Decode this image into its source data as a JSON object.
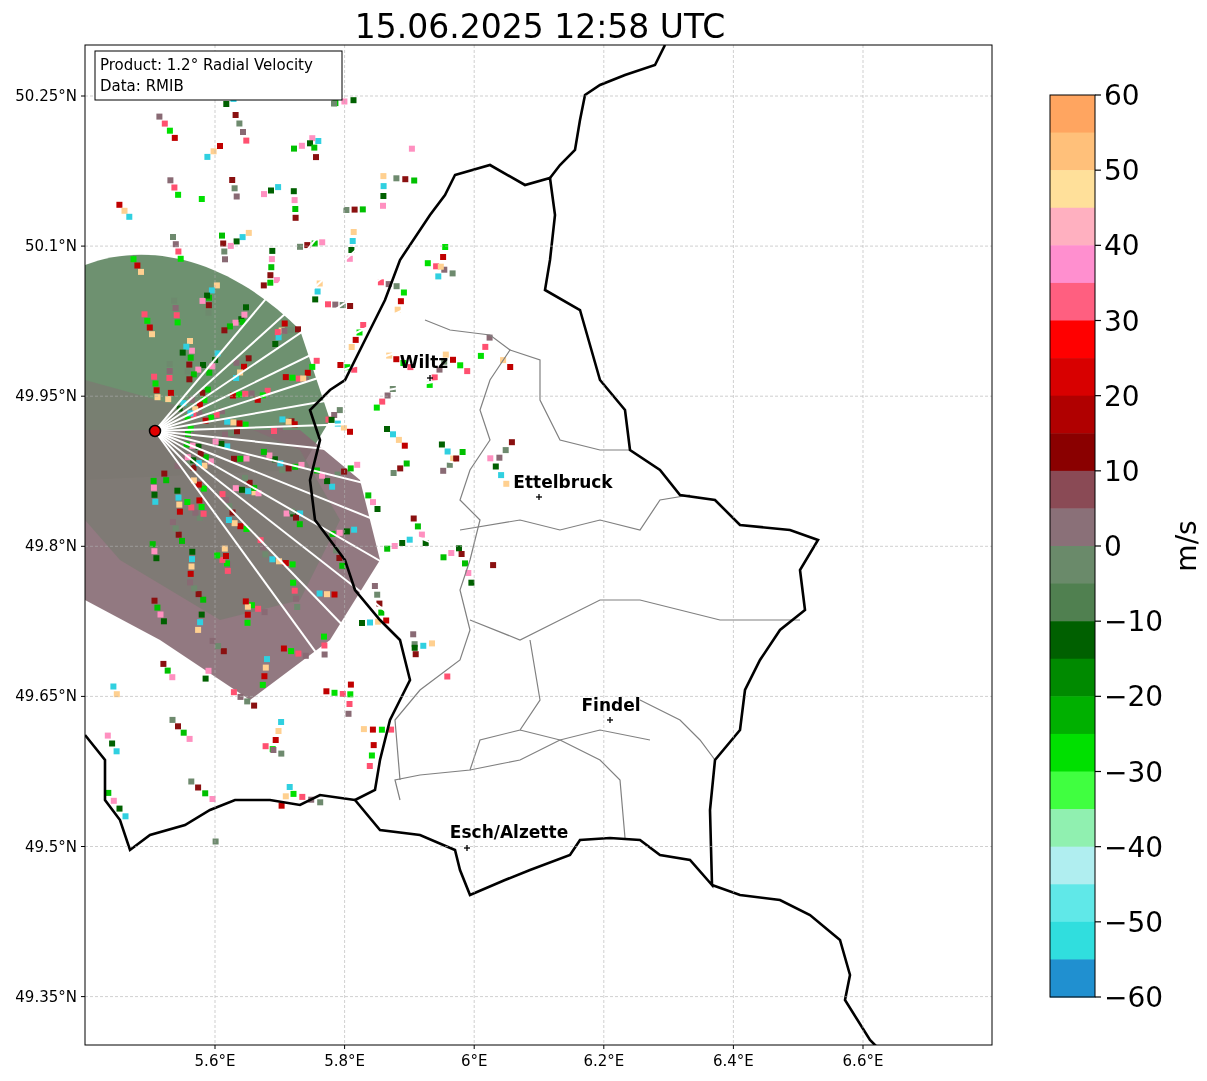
{
  "title": "15.06.2025 12:58 UTC",
  "info_box": [
    "Product: 1.2° Radial Velocity",
    "Data: RMIB"
  ],
  "x_ticks": [
    "5.6°E",
    "5.8°E",
    "6°E",
    "6.2°E",
    "6.4°E",
    "6.6°E"
  ],
  "y_ticks": [
    "50.25°N",
    "50.1°N",
    "49.95°N",
    "49.8°N",
    "49.65°N",
    "49.5°N",
    "49.35°N"
  ],
  "cities": [
    {
      "name": "Wiltz"
    },
    {
      "name": "Ettelbruck"
    },
    {
      "name": "Findel"
    },
    {
      "name": "Esch/Alzette"
    }
  ],
  "colorbar": {
    "label": "m/s",
    "ticks": [
      "60",
      "50",
      "40",
      "30",
      "20",
      "10",
      "0",
      "−10",
      "−20",
      "−30",
      "−40",
      "−50",
      "−60"
    ]
  }
}
